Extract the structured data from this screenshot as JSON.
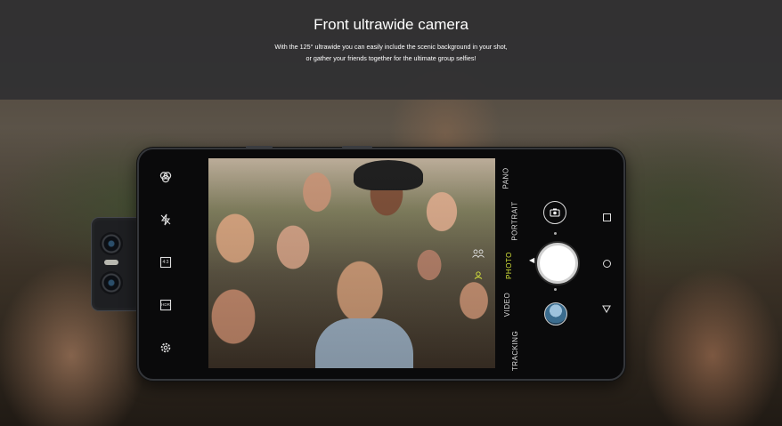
{
  "hero": {
    "title": "Front ultrawide camera",
    "subtitle_line1": "With the 125° ultrawide you can easily include the scenic background in your shot,",
    "subtitle_line2": "or gather your friends together for the ultimate group selfies!"
  },
  "camera": {
    "modes": [
      "PANO",
      "PORTRAIT",
      "PHOTO",
      "VIDEO",
      "TRACKING"
    ],
    "active_mode": "PHOTO",
    "left_toolbar": [
      "filter-icon",
      "flash-off-icon",
      "aspect-ratio-icon",
      "hdr-icon",
      "settings-icon"
    ],
    "aspect_label": "4:3",
    "hdr_label": "HDR",
    "accent_color": "#d8e63b"
  }
}
